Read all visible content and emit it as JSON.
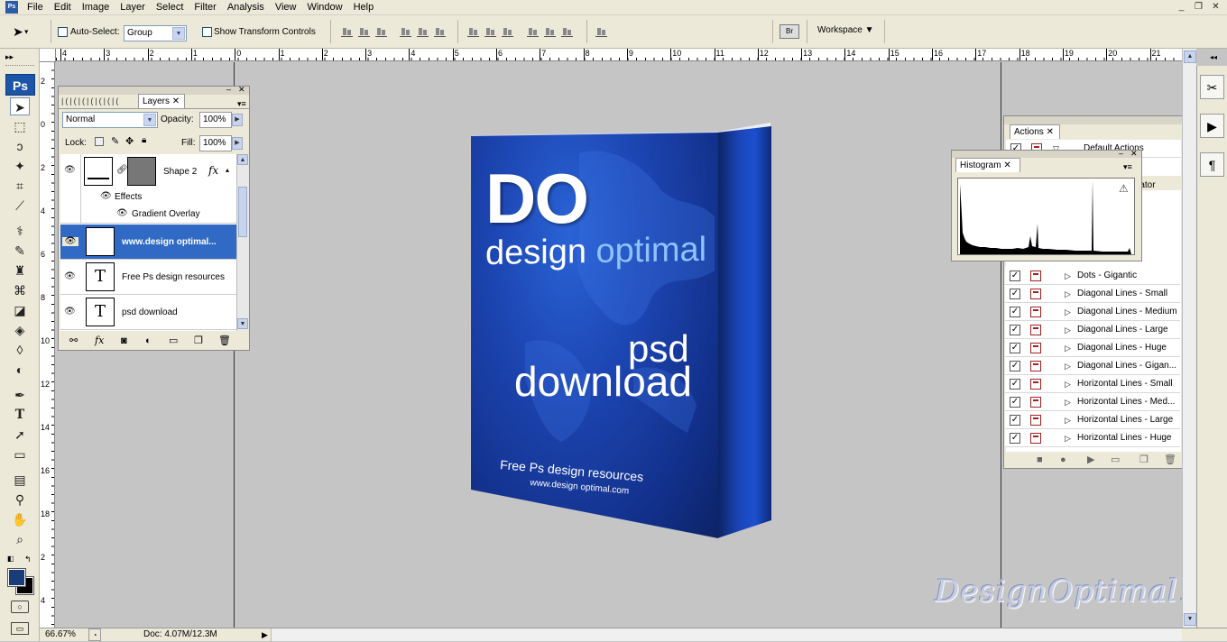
{
  "menu": {
    "app_badge": "Ps",
    "items": [
      "File",
      "Edit",
      "Image",
      "Layer",
      "Select",
      "Filter",
      "Analysis",
      "View",
      "Window",
      "Help"
    ],
    "window_buttons": [
      "_",
      "❐",
      "✕"
    ]
  },
  "options_bar": {
    "auto_select_label": "Auto-Select:",
    "auto_select_value": "Group",
    "show_transform_label": "Show Transform Controls",
    "workspace_label": "Workspace ▼"
  },
  "rulers": {
    "top_labels": [
      "4",
      "3",
      "2",
      "1",
      "0",
      "1",
      "2",
      "3",
      "4",
      "5",
      "6",
      "7",
      "8",
      "9",
      "10",
      "11",
      "12",
      "13",
      "14",
      "15",
      "16",
      "17",
      "18",
      "19",
      "20",
      "21"
    ],
    "left_labels": [
      "2",
      "0",
      "2",
      "4",
      "6",
      "8",
      "10",
      "12",
      "14",
      "16",
      "18",
      "2",
      "4"
    ]
  },
  "toolbar": {
    "badge": "Ps"
  },
  "layers_panel": {
    "tab_label": "Layers",
    "blend_mode": "Normal",
    "opacity_label": "Opacity:",
    "opacity_value": "100%",
    "lock_label": "Lock:",
    "fill_label": "Fill:",
    "fill_value": "100%",
    "shape_layer_name": "Shape 2",
    "effects_label": "Effects",
    "effect_name": "Gradient Overlay",
    "layers": [
      {
        "name": "www.design optimal...",
        "selected": true
      },
      {
        "name": "Free Ps design resources",
        "selected": false
      },
      {
        "name": "psd download",
        "selected": false
      }
    ]
  },
  "actions_panel": {
    "tab_label": "Actions",
    "set_label": "Default Actions",
    "partial_label": "mator",
    "items": [
      "Dots - Gigantic",
      "Diagonal Lines - Small",
      "Diagonal Lines - Medium",
      "Diagonal Lines - Large",
      "Diagonal Lines - Huge",
      "Diagonal Lines - Gigan...",
      "Horizontal Lines - Small",
      "Horizontal Lines - Med...",
      "Horizontal Lines - Large",
      "Horizontal Lines - Huge"
    ]
  },
  "histogram_panel": {
    "tab_label": "Histogram"
  },
  "canvas": {
    "box_do": "DO",
    "box_design": "design",
    "box_optimal": "optimal",
    "box_psd": "psd",
    "box_download": "download",
    "box_free": "Free Ps design resources",
    "box_url": "www.design optimal.com",
    "watermark": "DesignOptimal.com"
  },
  "status": {
    "zoom": "66.67%",
    "doc": "Doc: 4.07M/12.3M"
  }
}
